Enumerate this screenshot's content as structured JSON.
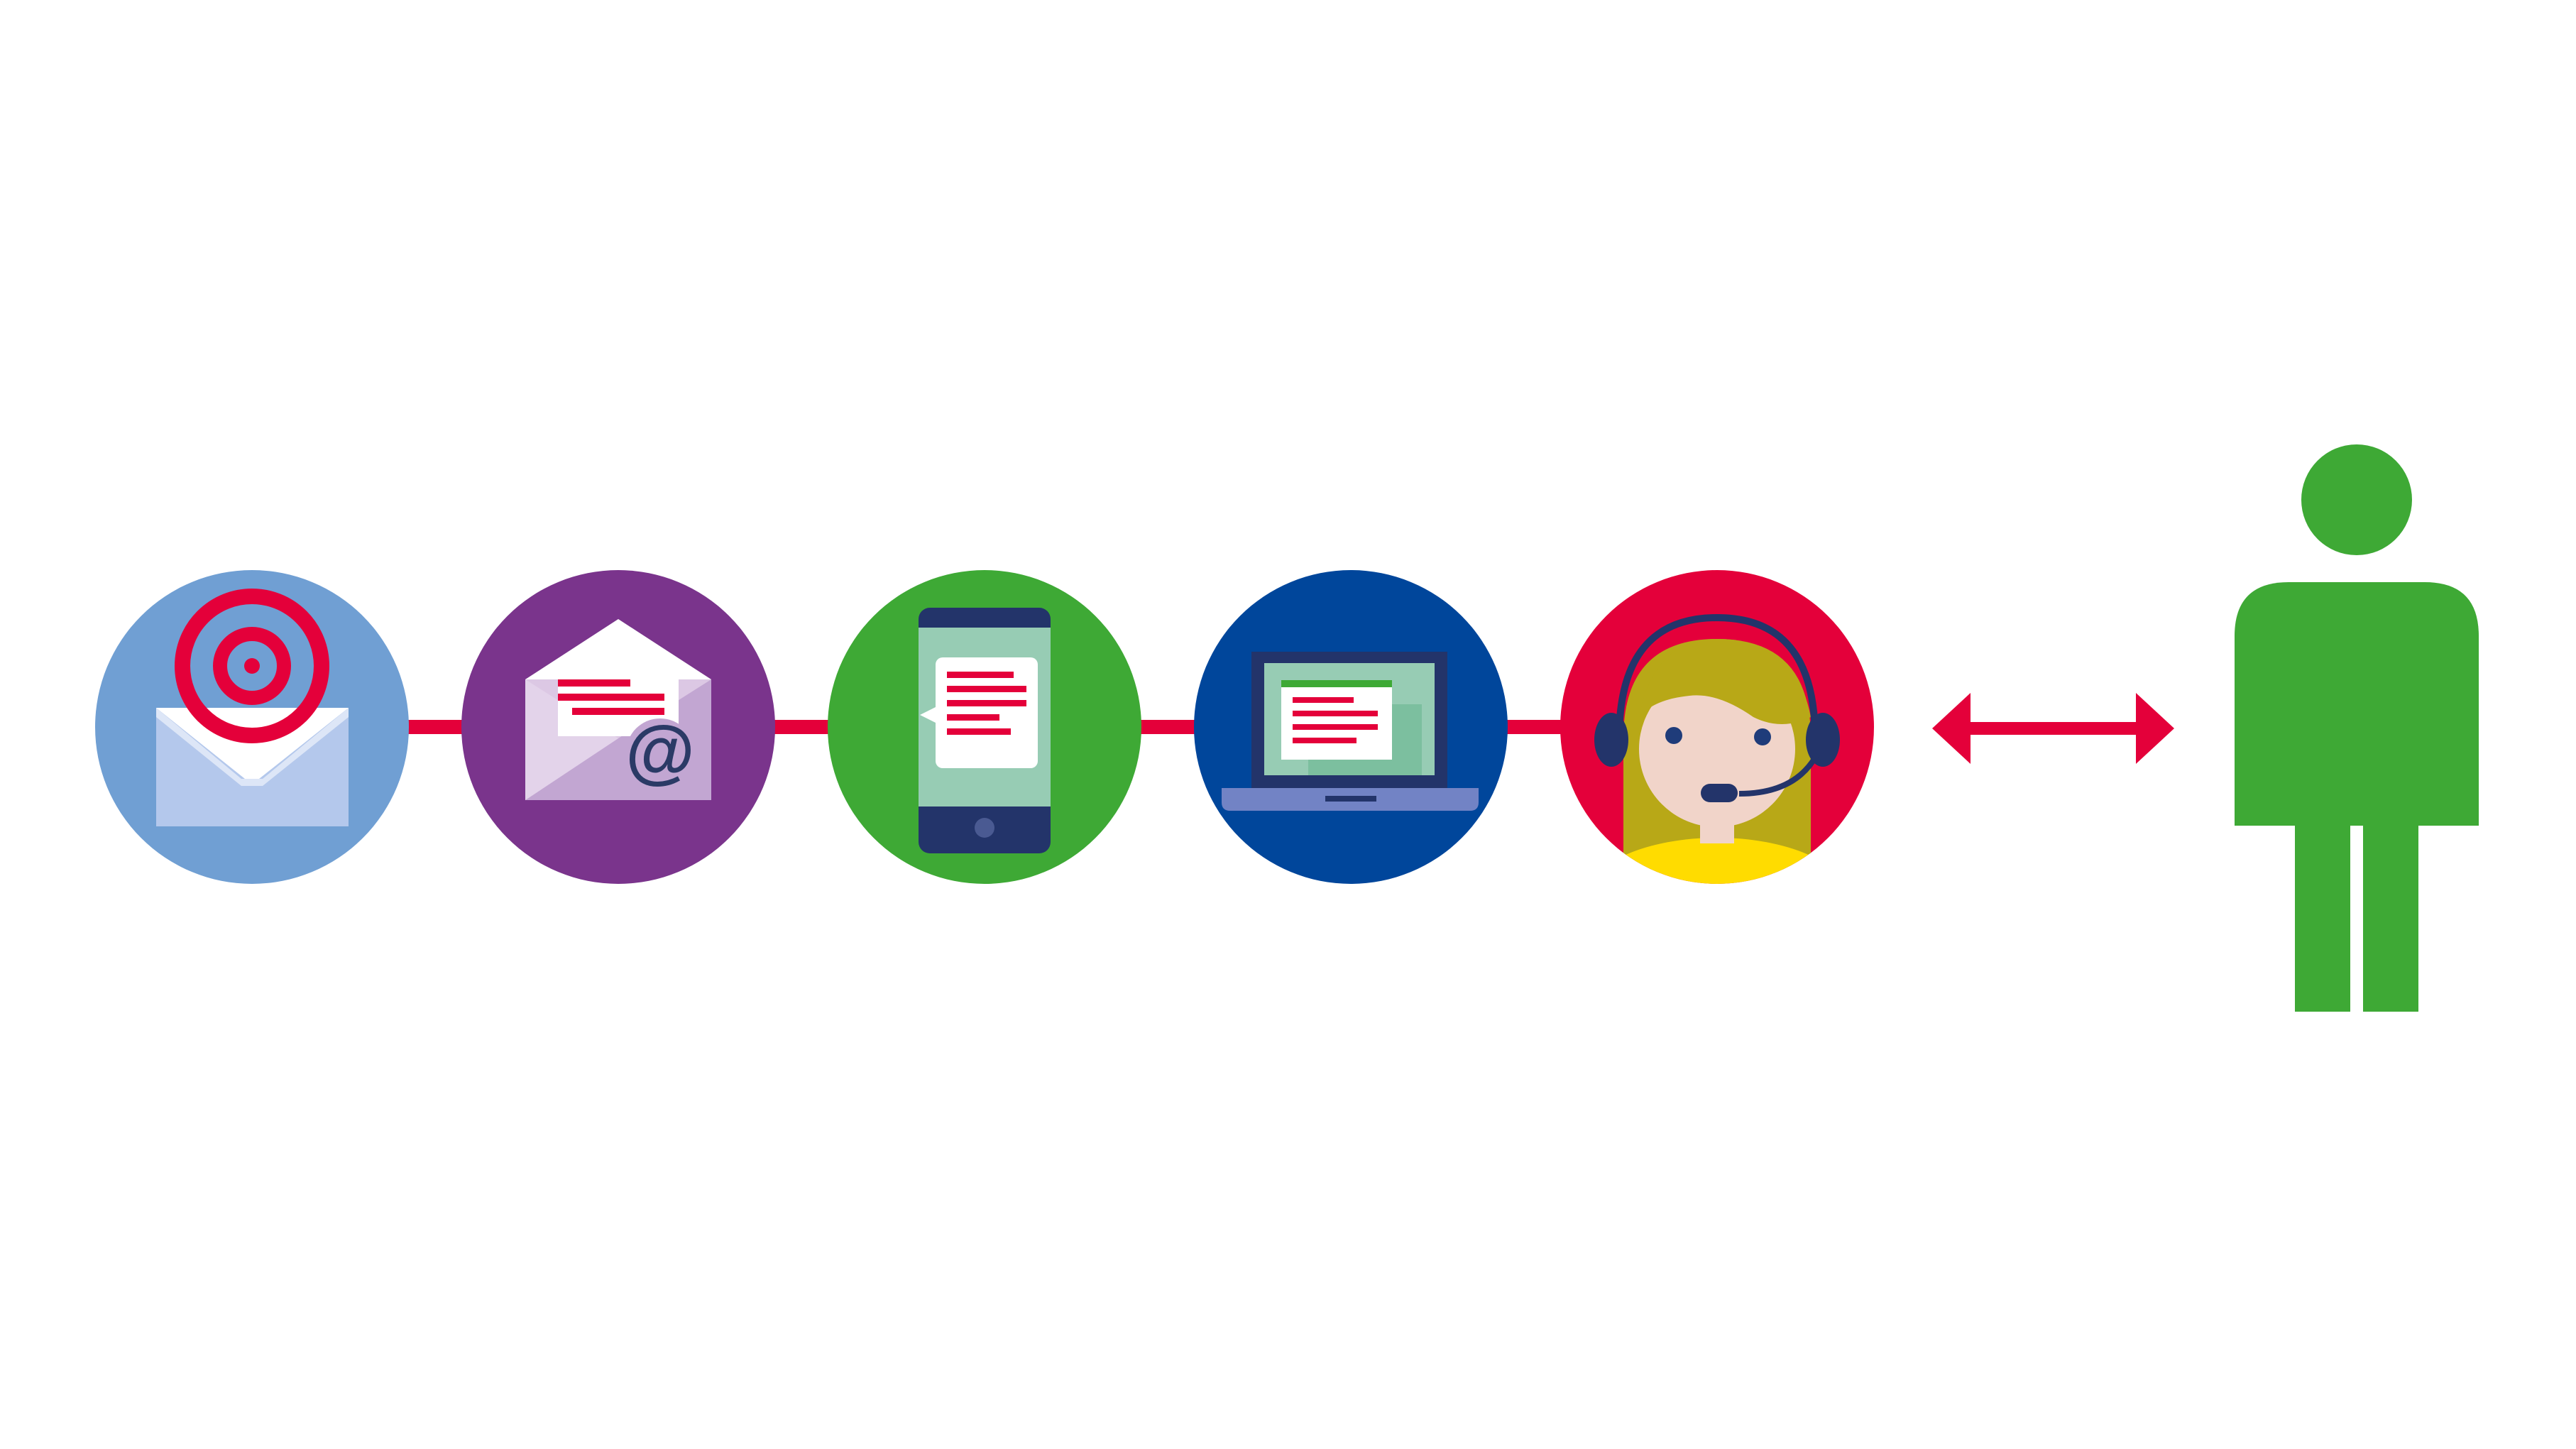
{
  "diagram": {
    "background": "#ffffff",
    "connector_color": "#e4003a",
    "channels": [
      {
        "id": "direct-mail",
        "icon": "envelope-target-icon",
        "color": "#709fd3"
      },
      {
        "id": "email",
        "icon": "open-envelope-at-icon",
        "color": "#7a348c"
      },
      {
        "id": "mobile",
        "icon": "smartphone-message-icon",
        "color": "#3ea935"
      },
      {
        "id": "web",
        "icon": "laptop-screen-icon",
        "color": "#00469b"
      },
      {
        "id": "call-center",
        "icon": "headset-agent-icon",
        "color": "#e4003a"
      }
    ],
    "arrow": {
      "icon": "double-arrow-icon",
      "color": "#e4003a"
    },
    "customer": {
      "icon": "person-icon",
      "color": "#3ea935"
    },
    "icon_text": {
      "email_symbol": "@"
    }
  }
}
